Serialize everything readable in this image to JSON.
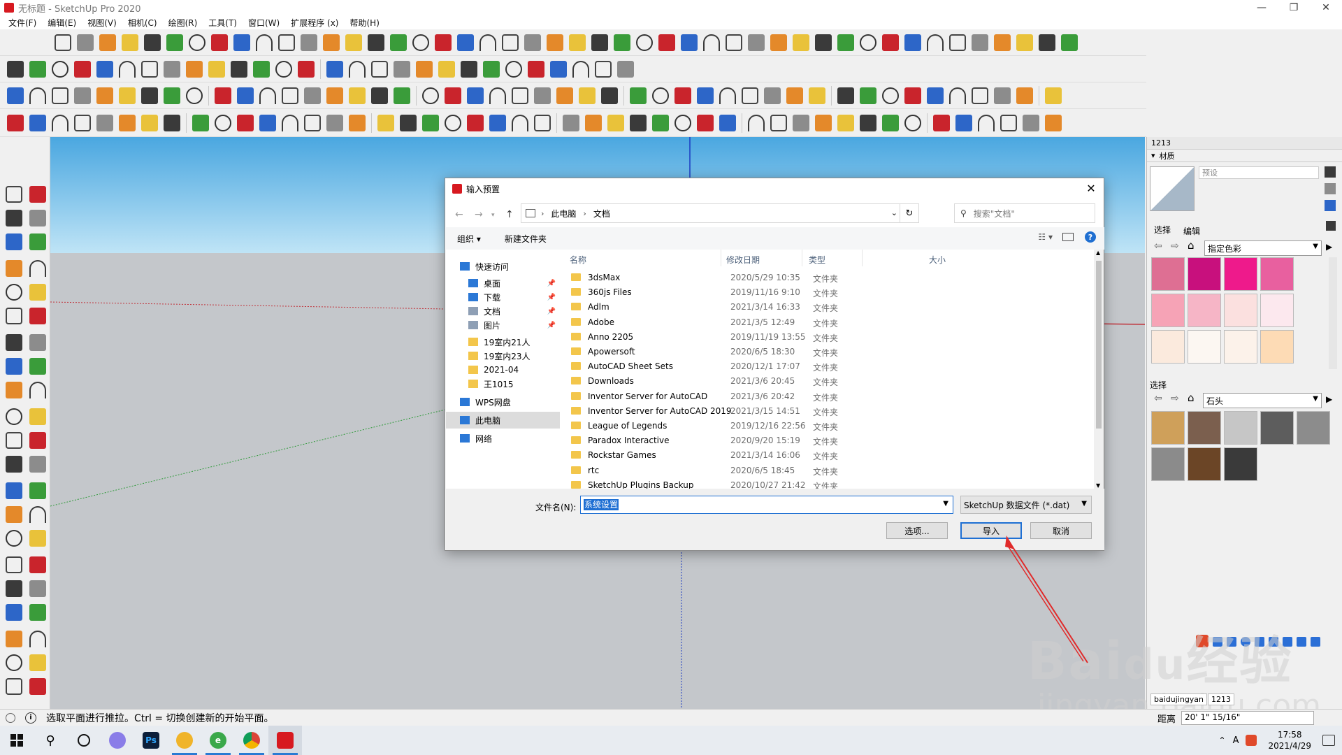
{
  "window": {
    "title": "无标题 - SketchUp Pro 2020",
    "buttons": [
      "—",
      "❐",
      "✕"
    ]
  },
  "menu": [
    "文件(F)",
    "编辑(E)",
    "视图(V)",
    "相机(C)",
    "绘图(R)",
    "工具(T)",
    "窗口(W)",
    "扩展程序 (x)",
    "帮助(H)"
  ],
  "right_panel": {
    "tray_title": "1213",
    "materials_title": "材质",
    "preset_label": "预设",
    "tab_select": "选择",
    "tab_edit": "编辑",
    "dropdown1": "指定色彩",
    "select2_label": "选择",
    "dropdown2": "石头",
    "swatches_colors": [
      "#de6f93",
      "#c8107d",
      "#ee1a8b",
      "#e8609f",
      "#f6a3b6",
      "#f6b5c6",
      "#fbe0df",
      "#fce8ee",
      "#fbeadd",
      "#fcf7f2",
      "#fcf2ea",
      "#fddbb5"
    ],
    "stone_colors": [
      "#cfa05a",
      "#7b5f4e",
      "#c6c6c6",
      "#5d5d5d",
      "#8c8c8c",
      "#8b8b8b",
      "#6b4526",
      "#3a3a3a"
    ]
  },
  "status": {
    "text": "选取平面进行推拉。Ctrl = 切换创建新的开始平面。",
    "measure_label": "距离",
    "measure_value": "20' 1\" 15/16\""
  },
  "watermark": {
    "label1": "baidujingyan",
    "label2": "1213"
  },
  "taskbar": {
    "time": "17:58",
    "date": "2021/4/29"
  },
  "dialog": {
    "title": "输入预置",
    "address": [
      "此电脑",
      "文档"
    ],
    "search_placeholder": "搜索\"文档\"",
    "organize": "组织 ▾",
    "new_folder": "新建文件夹",
    "columns": [
      "名称",
      "修改日期",
      "类型",
      "大小"
    ],
    "nav": [
      {
        "label": "快速访问",
        "icon": "star-icon",
        "pinned": false
      },
      {
        "label": "桌面",
        "icon": "desktop-icon",
        "pinned": true
      },
      {
        "label": "下载",
        "icon": "download-icon",
        "pinned": true
      },
      {
        "label": "文档",
        "icon": "document-icon",
        "pinned": true
      },
      {
        "label": "图片",
        "icon": "picture-icon",
        "pinned": true
      },
      {
        "label": "19室内21人",
        "icon": "folder-icon",
        "pinned": false
      },
      {
        "label": "19室内23人",
        "icon": "folder-icon",
        "pinned": false
      },
      {
        "label": "2021-04",
        "icon": "folder-icon",
        "pinned": false
      },
      {
        "label": "王1015",
        "icon": "folder-icon",
        "pinned": false
      },
      {
        "label": "WPS网盘",
        "icon": "cloud-icon",
        "pinned": false
      },
      {
        "label": "此电脑",
        "icon": "computer-icon",
        "pinned": false
      },
      {
        "label": "网络",
        "icon": "network-icon",
        "pinned": false
      }
    ],
    "files": [
      {
        "name": "3dsMax",
        "date": "2020/5/29 10:35",
        "type": "文件夹"
      },
      {
        "name": "360js Files",
        "date": "2019/11/16 9:10",
        "type": "文件夹"
      },
      {
        "name": "Adlm",
        "date": "2021/3/14 16:33",
        "type": "文件夹"
      },
      {
        "name": "Adobe",
        "date": "2021/3/5 12:49",
        "type": "文件夹"
      },
      {
        "name": "Anno 2205",
        "date": "2019/11/19 13:55",
        "type": "文件夹"
      },
      {
        "name": "Apowersoft",
        "date": "2020/6/5 18:30",
        "type": "文件夹"
      },
      {
        "name": "AutoCAD Sheet Sets",
        "date": "2020/12/1 17:07",
        "type": "文件夹"
      },
      {
        "name": "Downloads",
        "date": "2021/3/6 20:45",
        "type": "文件夹"
      },
      {
        "name": "Inventor Server for AutoCAD",
        "date": "2021/3/6 20:42",
        "type": "文件夹"
      },
      {
        "name": "Inventor Server for AutoCAD 2019",
        "date": "2021/3/15 14:51",
        "type": "文件夹"
      },
      {
        "name": "League of Legends",
        "date": "2019/12/16 22:56",
        "type": "文件夹"
      },
      {
        "name": "Paradox Interactive",
        "date": "2020/9/20 15:19",
        "type": "文件夹"
      },
      {
        "name": "Rockstar Games",
        "date": "2021/3/14 16:06",
        "type": "文件夹"
      },
      {
        "name": "rtc",
        "date": "2020/6/5 18:45",
        "type": "文件夹"
      },
      {
        "name": "SketchUp Plugins Backup",
        "date": "2020/10/27 21:42",
        "type": "文件夹"
      }
    ],
    "filename_label": "文件名(N):",
    "filename_value": "系统设置",
    "filetype_value": "SketchUp 数据文件 (*.dat)",
    "btn_options": "选项...",
    "btn_import": "导入",
    "btn_cancel": "取消"
  }
}
